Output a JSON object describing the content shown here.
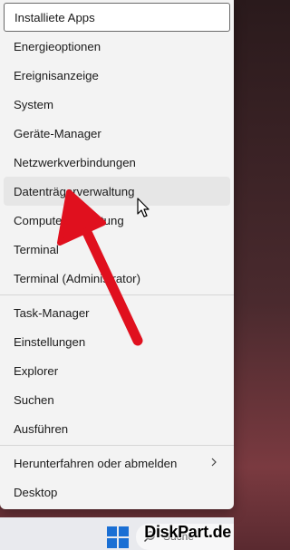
{
  "menu": {
    "items": [
      {
        "label": "Installiete Apps"
      },
      {
        "label": "Energieoptionen"
      },
      {
        "label": "Ereignisanzeige"
      },
      {
        "label": "System"
      },
      {
        "label": "Geräte-Manager"
      },
      {
        "label": "Netzwerkverbindungen"
      },
      {
        "label": "Datenträgerverwaltung"
      },
      {
        "label": "Computerverwaltung"
      },
      {
        "label": "Terminal"
      },
      {
        "label": "Terminal (Administrator)"
      },
      {
        "label": "Task-Manager"
      },
      {
        "label": "Einstellungen"
      },
      {
        "label": "Explorer"
      },
      {
        "label": "Suchen"
      },
      {
        "label": "Ausführen"
      },
      {
        "label": "Herunterfahren oder abmelden"
      },
      {
        "label": "Desktop"
      }
    ]
  },
  "taskbar": {
    "search_label": "Suche"
  },
  "watermark": "DiskPart.de",
  "colors": {
    "annotation_arrow": "#e0101e",
    "windows_logo": "#1a6fd4",
    "menu_background": "#f3f3f3"
  }
}
